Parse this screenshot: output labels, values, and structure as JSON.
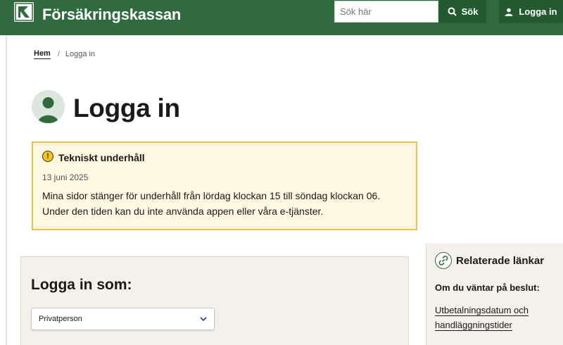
{
  "header": {
    "brand": "Försäkringskassan",
    "logo_icon": "forsakringskassan-logo-icon",
    "search_placeholder": "Sök här",
    "search_button": "Sök",
    "login_button": "Logga in",
    "brand_color": "#2f6b3c"
  },
  "breadcrumb": {
    "home": "Hem",
    "separator": "/",
    "current": "Logga in"
  },
  "page": {
    "title": "Logga in",
    "avatar_icon": "user-avatar-icon"
  },
  "alert": {
    "icon": "exclamation-circle-icon",
    "title": "Tekniskt underhåll",
    "date": "13 juni 2025",
    "line1": "Mina sidor stänger för underhåll från lördag klockan 15 till söndag klockan 06.",
    "line2": "Under den tiden kan du inte använda appen eller våra e-tjänster.",
    "border_color": "#e8c342",
    "background_color": "#fef7e2"
  },
  "login": {
    "heading": "Logga in som:",
    "selected_option": "Privatperson"
  },
  "related": {
    "icon": "link-icon",
    "title": "Relaterade länkar",
    "subtitle": "Om du väntar på beslut:",
    "link_line1": "Utbetalningsdatum och",
    "link_line2": "handläggningstider"
  }
}
